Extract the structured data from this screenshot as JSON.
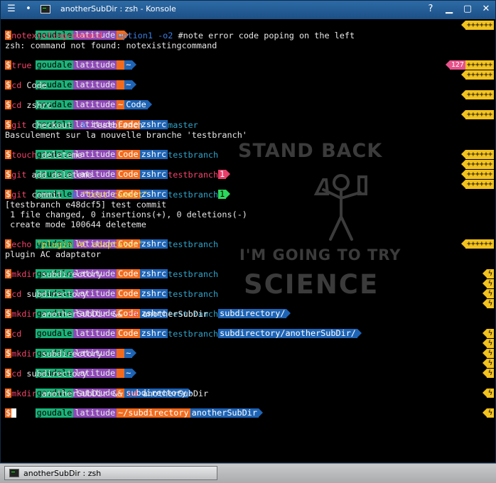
{
  "titlebar": {
    "menu_glyph": "☰",
    "pin_glyph": "•",
    "title": "anotherSubDir : zsh - Konsole",
    "buttons": [
      "?",
      "▁",
      "▢",
      "✕"
    ]
  },
  "watermark": {
    "line1": "STAND BACK",
    "line2": "I'M GOING TO TRY",
    "line3": "SCIENCE"
  },
  "prompt": {
    "user": "goudale",
    "host": "latitude",
    "dollar": "$",
    "tilde": "~",
    "code": "Code",
    "zshrc": "zshrc",
    "cross": "✘",
    "flags": "++++++",
    "lightning": "ϟ"
  },
  "terminal": {
    "l1_cmd": "notexistingcommand",
    "l1_args": " --option1 -o2 ",
    "l1_comment": "#note error code poping on the left",
    "l2_out": "zsh: command not found: notexistingcommand",
    "l4_cmd": "true",
    "l4_code": "127",
    "l6_cmd": "cd",
    "l6_arg": " Code",
    "l8_cmd": "cd",
    "l8_arg": " zshrc",
    "branch_master": "master",
    "l10_cmd": "git",
    "l10_args": " checkout ",
    "l10_flag": "-b",
    "l10_arg2": " testbranch",
    "l11_out": "Basculement sur la nouvelle branche 'testbranch'",
    "branch_test": "testbranch",
    "l13_cmd": "touch",
    "l13_arg": " deleteme",
    "l14_badge": "1",
    "l15_cmd": "git",
    "l15_arg": " add deleteme",
    "l16_badge": "1",
    "l17_cmd": "git",
    "l17_args": " commit ",
    "l17_flag": "-m",
    "l17_str": " \"test commit\"",
    "l18_out": "[testbranch e48dcf5] test commit",
    "l19_out": " 1 file changed, 0 insertions(+), 0 deletions(-)",
    "l20_out": " create mode 100644 deleteme",
    "l22_cmd": "echo",
    "l22_str": " \"plugin AC adaptator\"",
    "l23_out": "plugin AC adaptator",
    "l25_cmd": "mkdir",
    "l25_arg": " subdirectory",
    "l27_cmd": "cd",
    "l27_arg": " subdirectory",
    "dir_sub": "subdirectory/",
    "l29_cmd": "mkdir",
    "l29_arg": " anotherSubDir && ",
    "l29_cmd2": "cd",
    "l29_arg2": " anotherSubDir",
    "dir_another": "subdirectory/anotherSubDir/",
    "l31_cmd": "cd",
    "l33_cmd": "mkdir",
    "l33_arg": " subdirectory",
    "l35_cmd": "cd",
    "l35_arg": " subdirectory",
    "dir_sub2": "subdirectory",
    "l37_cmd": "mkdir",
    "l37_arg": " anotherSubDir && ",
    "l37_cmd2": "cd",
    "l37_arg2": " anotherSubDir",
    "dir_tilde_sub": "~/subdirectory",
    "dir_another2": "anotherSubDir"
  },
  "taskbar": {
    "task_label": "anotherSubDir : zsh"
  }
}
